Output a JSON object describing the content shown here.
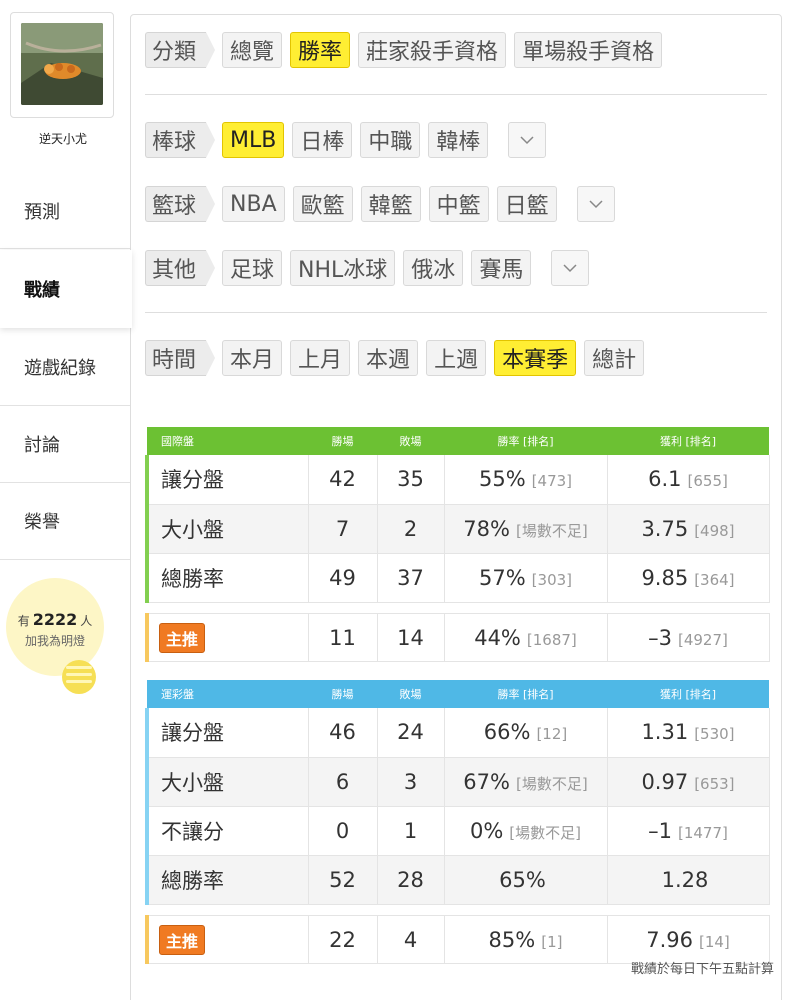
{
  "user": {
    "name": "逆天小尤"
  },
  "nav": [
    {
      "label": "預測"
    },
    {
      "label": "戰績"
    },
    {
      "label": "遊戲紀錄"
    },
    {
      "label": "討論"
    },
    {
      "label": "榮譽"
    }
  ],
  "fans": {
    "prefix": "有",
    "count": "2222",
    "suffix": "人",
    "subtitle": "加我為明燈"
  },
  "filters": {
    "category": {
      "label": "分類",
      "options": [
        "總覽",
        "勝率",
        "莊家殺手資格",
        "單場殺手資格"
      ],
      "selected": "勝率"
    },
    "baseball": {
      "label": "棒球",
      "options": [
        "MLB",
        "日棒",
        "中職",
        "韓棒"
      ],
      "selected": "MLB"
    },
    "basketball": {
      "label": "籃球",
      "options": [
        "NBA",
        "歐籃",
        "韓籃",
        "中籃",
        "日籃"
      ],
      "selected": ""
    },
    "other": {
      "label": "其他",
      "options": [
        "足球",
        "NHL冰球",
        "俄冰",
        "賽馬"
      ],
      "selected": ""
    },
    "time": {
      "label": "時間",
      "options": [
        "本月",
        "上月",
        "本週",
        "上週",
        "本賽季",
        "總計"
      ],
      "selected": "本賽季"
    }
  },
  "international": {
    "headers": [
      "國際盤",
      "勝場",
      "敗場",
      "勝率 [排名]",
      "獲利 [排名]"
    ],
    "rows": [
      {
        "name": "讓分盤",
        "win": "42",
        "lose": "35",
        "rate": "55%",
        "rate_rank": "[473]",
        "profit": "6.1",
        "profit_rank": "[655]"
      },
      {
        "name": "大小盤",
        "win": "7",
        "lose": "2",
        "rate": "78%",
        "rate_rank": "[場數不足]",
        "profit": "3.75",
        "profit_rank": "[498]"
      },
      {
        "name": "總勝率",
        "win": "49",
        "lose": "37",
        "rate": "57%",
        "rate_rank": "[303]",
        "profit": "9.85",
        "profit_rank": "[364]"
      }
    ],
    "featured": {
      "badge": "主推",
      "win": "11",
      "lose": "14",
      "rate": "44%",
      "rate_rank": "[1687]",
      "profit": "–3",
      "profit_rank": "[4927]"
    }
  },
  "sports_lottery": {
    "headers": [
      "運彩盤",
      "勝場",
      "敗場",
      "勝率 [排名]",
      "獲利 [排名]"
    ],
    "rows": [
      {
        "name": "讓分盤",
        "win": "46",
        "lose": "24",
        "rate": "66%",
        "rate_rank": "[12]",
        "profit": "1.31",
        "profit_rank": "[530]"
      },
      {
        "name": "大小盤",
        "win": "6",
        "lose": "3",
        "rate": "67%",
        "rate_rank": "[場數不足]",
        "profit": "0.97",
        "profit_rank": "[653]"
      },
      {
        "name": "不讓分",
        "win": "0",
        "lose": "1",
        "rate": "0%",
        "rate_rank": "[場數不足]",
        "profit": "–1",
        "profit_rank": "[1477]"
      },
      {
        "name": "總勝率",
        "win": "52",
        "lose": "28",
        "rate": "65%",
        "rate_rank": "",
        "profit": "1.28",
        "profit_rank": ""
      }
    ],
    "featured": {
      "badge": "主推",
      "win": "22",
      "lose": "4",
      "rate": "85%",
      "rate_rank": "[1]",
      "profit": "7.96",
      "profit_rank": "[14]"
    }
  },
  "footnote": "戰績於每日下午五點計算",
  "colors": {
    "active_chip": "#ffee33",
    "green_header": "#6cc133",
    "blue_header": "#4fb8e6",
    "badge": "#f07a22"
  }
}
